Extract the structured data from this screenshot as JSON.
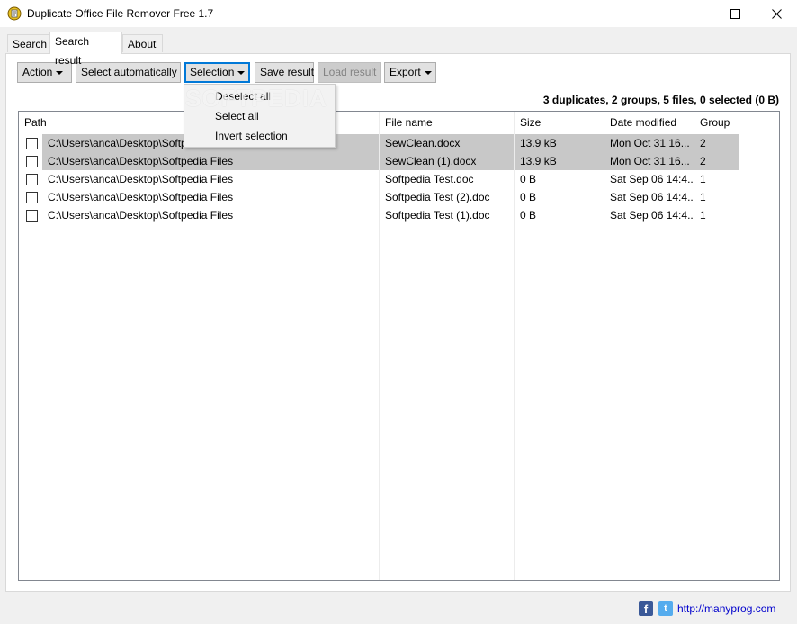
{
  "window": {
    "title": "Duplicate Office File Remover Free 1.7"
  },
  "tabs": [
    {
      "label": "Search"
    },
    {
      "label": "Search result"
    },
    {
      "label": "About"
    }
  ],
  "toolbar": {
    "action": "Action",
    "select_auto": "Select automatically",
    "selection": "Selection",
    "save_result": "Save result",
    "load_result": "Load result",
    "export": "Export"
  },
  "summary": "3 duplicates, 2 groups, 5 files, 0 selected (0 B)",
  "selection_menu": {
    "items": [
      "Deselect all",
      "Select all",
      "Invert selection"
    ]
  },
  "watermark": "SOFTPEDIA",
  "table": {
    "columns": [
      "Path",
      "File name",
      "Size",
      "Date modified",
      "Group"
    ],
    "rows": [
      {
        "path": "C:\\Users\\anca\\Desktop\\Softpedia Files",
        "name": "SewClean.docx",
        "size": "13.9 kB",
        "date": "Mon Oct 31 16...",
        "group": "2",
        "checked": false,
        "highlighted": true
      },
      {
        "path": "C:\\Users\\anca\\Desktop\\Softpedia Files",
        "name": "SewClean (1).docx",
        "size": "13.9 kB",
        "date": "Mon Oct 31 16...",
        "group": "2",
        "checked": false,
        "highlighted": true
      },
      {
        "path": "C:\\Users\\anca\\Desktop\\Softpedia Files",
        "name": "Softpedia Test.doc",
        "size": "0 B",
        "date": "Sat Sep 06 14:4...",
        "group": "1",
        "checked": false,
        "highlighted": false
      },
      {
        "path": "C:\\Users\\anca\\Desktop\\Softpedia Files",
        "name": "Softpedia Test (2).doc",
        "size": "0 B",
        "date": "Sat Sep 06 14:4...",
        "group": "1",
        "checked": false,
        "highlighted": false
      },
      {
        "path": "C:\\Users\\anca\\Desktop\\Softpedia Files",
        "name": "Softpedia Test (1).doc",
        "size": "0 B",
        "date": "Sat Sep 06 14:4...",
        "group": "1",
        "checked": false,
        "highlighted": false
      }
    ]
  },
  "footer": {
    "link": "http://manyprog.com",
    "facebook_icon": "f",
    "twitter_icon": "t"
  }
}
